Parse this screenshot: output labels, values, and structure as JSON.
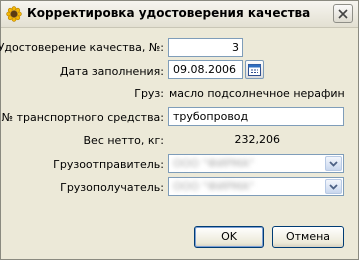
{
  "window": {
    "title": "Корректировка удостоверения качества"
  },
  "icons": {
    "app": "sunflower-icon",
    "close": "close-icon",
    "calendar": "calendar-icon",
    "dropdown": "chevron-down-icon"
  },
  "form": {
    "certificate": {
      "label": "Удостоверение качества, №:",
      "value": "3"
    },
    "fill_date": {
      "label": "Дата заполнения:",
      "value": "09.08.2006"
    },
    "cargo": {
      "label": "Груз:",
      "value": "масло подсолнечное нерафинированное"
    },
    "vehicle": {
      "label": "№ транспортного средства:",
      "value": "трубопровод"
    },
    "net_weight": {
      "label": "Вес нетто, кг:",
      "value": "232,206"
    },
    "shipper": {
      "label": "Грузоотправитель:",
      "value": "ООО \"ФИРМА\""
    },
    "consignee": {
      "label": "Грузополучатель:",
      "value": "ООО \"ФИРМА\""
    }
  },
  "buttons": {
    "ok": "OK",
    "cancel": "Отмена"
  }
}
